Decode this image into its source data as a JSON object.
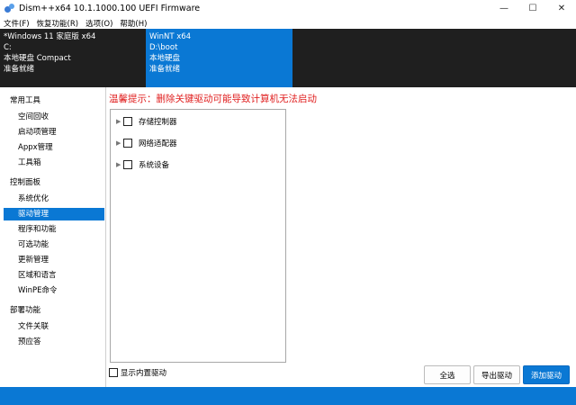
{
  "window": {
    "title": "Dism++x64 10.1.1000.100 UEFI Firmware",
    "minimize": "—",
    "maximize": "☐",
    "close": "✕"
  },
  "menu": [
    "文件(F)",
    "恢复功能(R)",
    "选项(O)",
    "帮助(H)"
  ],
  "sessions": [
    {
      "line1": "*Windows 11 家庭版 x64",
      "line2": "C:",
      "line3": "本地硬盘 Compact",
      "line4": "准备就绪"
    },
    {
      "line1": "WinNT x64",
      "line2": "D:\\boot",
      "line3": "本地硬盘",
      "line4": "准备就绪"
    }
  ],
  "sidebar": {
    "groups": [
      "常用工具",
      "控制面板",
      "部署功能"
    ],
    "tools": [
      "空间回收",
      "启动项管理",
      "Appx管理",
      "工具箱"
    ],
    "control": [
      "系统优化",
      "驱动管理",
      "程序和功能",
      "可选功能",
      "更新管理",
      "区域和语言",
      "WinPE命令"
    ],
    "deploy": [
      "文件关联",
      "预应答"
    ],
    "active": "驱动管理"
  },
  "main": {
    "warning": "温馨提示：删除关键驱动可能导致计算机无法启动",
    "tree": [
      "存储控制器",
      "网络适配器",
      "系统设备"
    ],
    "show_builtin": "显示内置驱动",
    "buttons": {
      "select_all": "全选",
      "export": "导出驱动",
      "add": "添加驱动"
    }
  },
  "colors": {
    "accent": "#0a78d4",
    "warning": "#e02020",
    "header_dark": "#1f1f1f"
  }
}
